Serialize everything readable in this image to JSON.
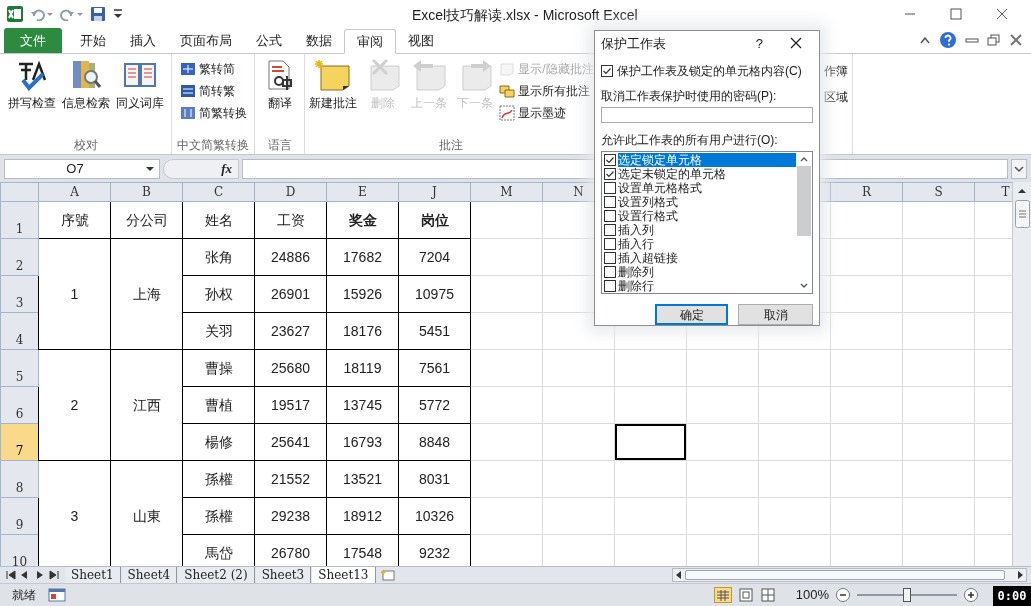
{
  "window": {
    "title": "Excel技巧解读.xlsx  -  Microsoft Excel"
  },
  "ribbon_tabs": [
    {
      "label": "文件",
      "kind": "file",
      "selected": false
    },
    {
      "label": "开始",
      "kind": "tab",
      "selected": false
    },
    {
      "label": "插入",
      "kind": "tab",
      "selected": false
    },
    {
      "label": "页面布局",
      "kind": "tab",
      "selected": false
    },
    {
      "label": "公式",
      "kind": "tab",
      "selected": false
    },
    {
      "label": "数据",
      "kind": "tab",
      "selected": false
    },
    {
      "label": "审阅",
      "kind": "tab",
      "selected": true
    },
    {
      "label": "视图",
      "kind": "tab",
      "selected": false
    }
  ],
  "ribbon_groups": [
    {
      "label": "校对",
      "items": [
        {
          "label": "拼写检查",
          "kind": "large",
          "disabled": false
        },
        {
          "label": "信息检索",
          "kind": "large",
          "disabled": false
        },
        {
          "label": "同义词库",
          "kind": "large",
          "disabled": false
        }
      ]
    },
    {
      "label": "中文简繁转换",
      "items": [
        {
          "label": "繁转简",
          "kind": "small",
          "disabled": false
        },
        {
          "label": "简转繁",
          "kind": "small",
          "disabled": false
        },
        {
          "label": "简繁转换",
          "kind": "small",
          "disabled": false
        }
      ]
    },
    {
      "label": "语言",
      "items": [
        {
          "label": "翻译",
          "kind": "large",
          "disabled": false
        }
      ]
    },
    {
      "label": "批注",
      "items": [
        {
          "label": "新建批注",
          "kind": "large",
          "disabled": false
        },
        {
          "label": "删除",
          "kind": "large",
          "disabled": true
        },
        {
          "label": "上一条",
          "kind": "large",
          "disabled": true
        },
        {
          "label": "下一条",
          "kind": "large",
          "disabled": true
        },
        {
          "label": "显示/隐藏批注",
          "kind": "small",
          "disabled": true
        },
        {
          "label": "显示所有批注",
          "kind": "small",
          "disabled": false
        },
        {
          "label": "显示墨迹",
          "kind": "small",
          "disabled": false
        }
      ]
    },
    {
      "items": [
        {
          "label": "作簿",
          "kind": "clipped",
          "disabled": false
        },
        {
          "label": "区域",
          "kind": "clipped",
          "disabled": false
        }
      ]
    }
  ],
  "name_box": {
    "value": "O7"
  },
  "formula_bar": {
    "function_label": "fx"
  },
  "sheet": {
    "columns_left": [
      "A",
      "B",
      "C",
      "D",
      "E",
      "J",
      "M",
      "N"
    ],
    "columns_right": [
      "R",
      "S",
      "T"
    ],
    "row_headers": [
      {
        "label": "1",
        "selected": false
      },
      {
        "label": "2",
        "selected": false
      },
      {
        "label": "3",
        "selected": false
      },
      {
        "label": "4",
        "selected": false
      },
      {
        "label": "5",
        "selected": false
      },
      {
        "label": "6",
        "selected": false
      },
      {
        "label": "7",
        "selected": true
      },
      {
        "label": "8",
        "selected": false
      },
      {
        "label": "9",
        "selected": false
      },
      {
        "label": "10",
        "selected": false
      }
    ],
    "header_cells": [
      {
        "text": "序號",
        "bold": false
      },
      {
        "text": "分公司",
        "bold": false
      },
      {
        "text": "姓名",
        "bold": false
      },
      {
        "text": "工资",
        "bold": false
      },
      {
        "text": "奖金",
        "bold": true
      },
      {
        "text": "岗位",
        "bold": true
      }
    ],
    "groups": [
      {
        "number": "1",
        "branch": "上海",
        "people": [
          {
            "name": "张角",
            "salary": "24886",
            "bonus": "17682",
            "post": "7204"
          },
          {
            "name": "孙权",
            "salary": "26901",
            "bonus": "15926",
            "post": "10975"
          },
          {
            "name": "关羽",
            "salary": "23627",
            "bonus": "18176",
            "post": "5451"
          }
        ]
      },
      {
        "number": "2",
        "branch": "江西",
        "people": [
          {
            "name": "曹操",
            "salary": "25680",
            "bonus": "18119",
            "post": "7561"
          },
          {
            "name": "曹植",
            "salary": "19517",
            "bonus": "13745",
            "post": "5772"
          },
          {
            "name": "楊修",
            "salary": "25641",
            "bonus": "16793",
            "post": "8848"
          }
        ]
      },
      {
        "number": "3",
        "branch": "山東",
        "people": [
          {
            "name": "孫權",
            "salary": "21552",
            "bonus": "13521",
            "post": "8031"
          },
          {
            "name": "孫權",
            "salary": "29238",
            "bonus": "18912",
            "post": "10326"
          },
          {
            "name": "馬岱",
            "salary": "26780",
            "bonus": "17548",
            "post": "9232"
          }
        ]
      }
    ]
  },
  "sheet_tabs": [
    {
      "label": "Sheet1",
      "selected": false
    },
    {
      "label": "Sheet4",
      "selected": false
    },
    {
      "label": "Sheet2 (2)",
      "selected": false
    },
    {
      "label": "Sheet3",
      "selected": false
    },
    {
      "label": "Sheet13",
      "selected": true
    }
  ],
  "status_bar": {
    "status": "就绪",
    "zoom": "100%",
    "zoom_slider": {
      "level": 0.5
    }
  },
  "dialog": {
    "title": "保护工作表",
    "help": "?",
    "protect": {
      "label": "保护工作表及锁定的单元格内容(C)",
      "checked": true
    },
    "password_label": "取消工作表保护时使用的密码(P):",
    "allow_label": "允许此工作表的所有用户进行(O):",
    "options": [
      {
        "label": "选定锁定单元格",
        "checked": true,
        "selected": true
      },
      {
        "label": "选定未锁定的单元格",
        "checked": true,
        "selected": false
      },
      {
        "label": "设置单元格格式",
        "checked": false,
        "selected": false
      },
      {
        "label": "设置列格式",
        "checked": false,
        "selected": false
      },
      {
        "label": "设置行格式",
        "checked": false,
        "selected": false
      },
      {
        "label": "插入列",
        "checked": false,
        "selected": false
      },
      {
        "label": "插入行",
        "checked": false,
        "selected": false
      },
      {
        "label": "插入超链接",
        "checked": false,
        "selected": false
      },
      {
        "label": "删除列",
        "checked": false,
        "selected": false
      },
      {
        "label": "删除行",
        "checked": false,
        "selected": false
      }
    ],
    "buttons": [
      {
        "label": "确定",
        "kind": "default"
      },
      {
        "label": "取消",
        "kind": "normal"
      }
    ]
  },
  "recording_timer": "0:00"
}
